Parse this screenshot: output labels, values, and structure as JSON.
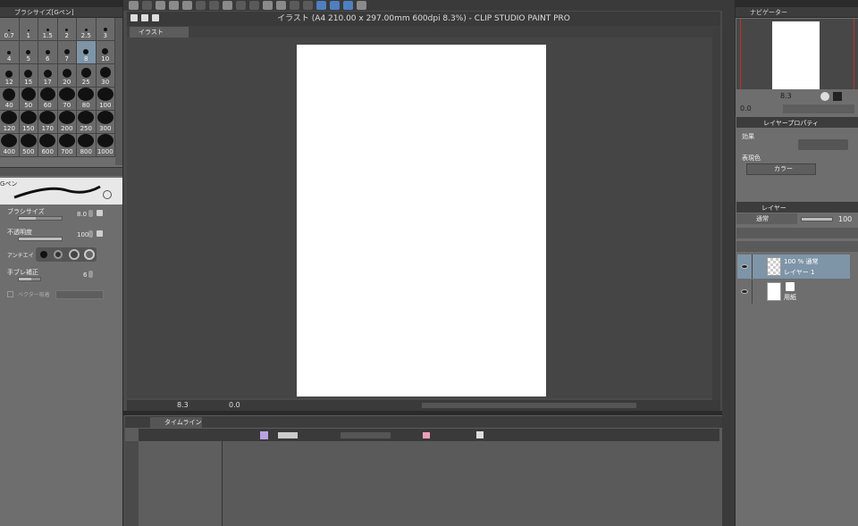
{
  "app": {
    "title": "イラスト (A4 210.00 x 297.00mm 600dpi 8.3%)  - CLIP STUDIO PAINT PRO"
  },
  "left_panel": {
    "brush_size_tab": "ブラシサイズ[Gペン]",
    "brush_sizes": [
      "0.7",
      "1",
      "1.5",
      "2",
      "2.5",
      "3",
      "4",
      "5",
      "6",
      "7",
      "8",
      "10",
      "12",
      "15",
      "17",
      "20",
      "25",
      "30",
      "40",
      "50",
      "60",
      "70",
      "80",
      "100",
      "120",
      "150",
      "170",
      "200",
      "250",
      "300",
      "400",
      "500",
      "600",
      "700",
      "800",
      "1000"
    ],
    "selected_size": "8",
    "tool_name": "Gペン",
    "props": {
      "brush_size_label": "ブラシサイズ",
      "brush_size_value": "8.0",
      "opacity_label": "不透明度",
      "opacity_value": "100",
      "antialias_label": "アンチエイ",
      "stabilization_label": "手ブレ補正",
      "stabilization_value": "6",
      "vector_label": "ベクター吸着"
    }
  },
  "document": {
    "tab_label": "イラスト",
    "zoom_value": "8.3",
    "rotation_value": "0.0"
  },
  "timeline": {
    "tab_label": "タイムライン"
  },
  "right_panel": {
    "navigator_tab": "ナビゲーター",
    "nav_zoom": "8.3",
    "nav_rotation": "0.0",
    "layer_property_tab": "レイヤープロパティ",
    "effect_label": "効果",
    "display_color_label": "表現色",
    "display_color_value": "カラー",
    "layer_tab": "レイヤー",
    "blend_mode": "通常",
    "layer_opacity": "100",
    "layers": [
      {
        "mode": "100 % 通常",
        "name": "レイヤー 1"
      },
      {
        "mode": "",
        "name": "用紙"
      }
    ]
  }
}
